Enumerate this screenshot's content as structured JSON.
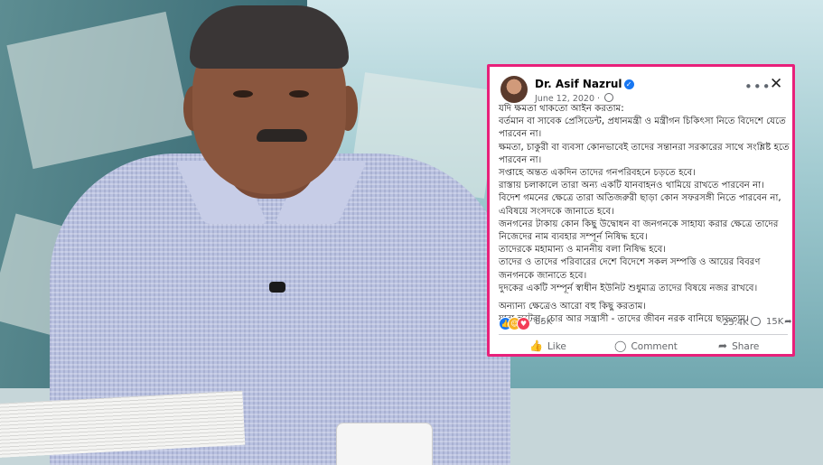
{
  "post": {
    "author": "Dr. Asif Nazrul",
    "date": "June 12, 2020",
    "more_icon": "more-horizontal-icon",
    "close_icon": "close-icon",
    "lines": [
      "যদি ক্ষমতা থাকতো আইন করতাম:",
      "বর্তমান বা সাবেক প্রেসিডেন্ট, প্রধানমন্ত্রী ও মন্ত্রীগন চিকিৎসা নিতে বিদেশে যেতে পারবেন না।",
      "ক্ষমতা, চাকুরী বা ব্যবসা কোনভাবেই তাদের সন্তানরা সরকারের সাথে সংশ্লিষ্ট হতে পারবেন না।",
      "সপ্তাহে অন্তত একদিন তাদের গনপরিবহনে চড়তে হবে।",
      "রাস্তায় চলাকালে তারা অন্য একটি যানবাহনও থামিয়ে রাখতে পারবেন না।",
      "বিদেশ গমনের ক্ষেত্রে তারা অতিজরুরী ছাড়া কোন সফরসঙ্গী নিতে পারবেন না, এবিষয়ে সংসদকে জানাতে হবে।",
      "জনগনের টাকায় কোন কিছু উদ্বোধন বা জনগনকে সাহায্য করার ক্ষেত্রে তাদের নিজেদের নাম ব্যবহার সম্পূর্ন নিষিদ্ধ হবে।",
      "তাদেরকে মহামান্য ও মাননীয় বলা নিষিদ্ধ হবে।",
      "তাদের ও তাদের পরিবারের দেশে বিদেশে সকল সম্পত্তি ও আয়ের বিবরণ জনগনকে জানাতে হবে।",
      "দুদকের একটি সম্পূর্ন স্বাধীন ইউনিট শুধুমাত্র তাদের বিষয়ে নজর রাখবে।"
    ],
    "lines2": [
      "অন্যান্য ক্ষেত্রেও আরো বহু কিছু করতাম।",
      "যারা লুটেরা, চোর আর সন্ত্রাসী - তাদের জীবন নরক বানিয়ে ছাড়তাম।"
    ],
    "reactions_count": "85K",
    "comments_count": "25.4K",
    "shares_count": "15K",
    "actions": {
      "like": "Like",
      "comment": "Comment",
      "share": "Share"
    },
    "colors": {
      "border": "#e8207a",
      "link_blue": "#1877f2"
    }
  }
}
